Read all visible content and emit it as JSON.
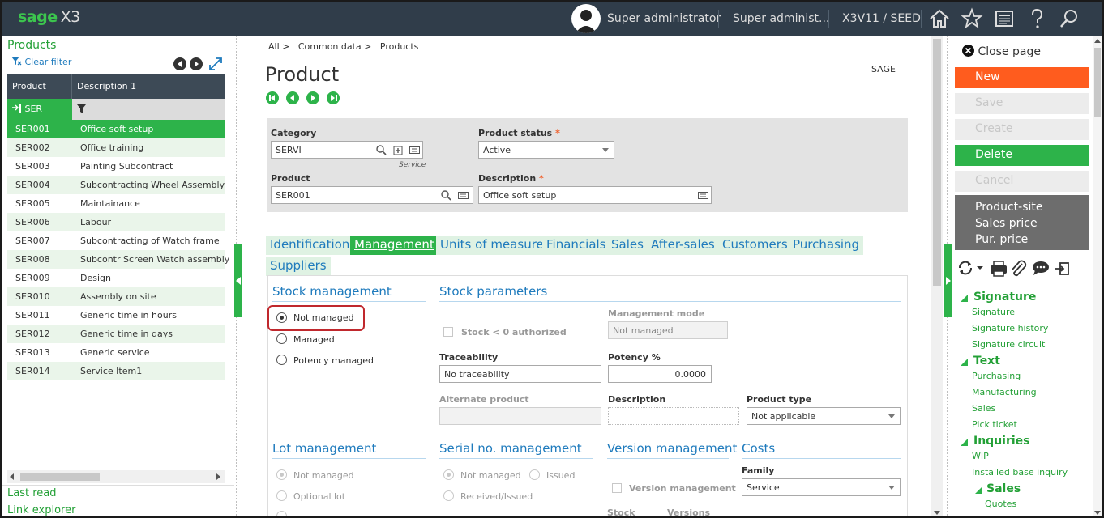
{
  "topbar": {
    "logo_brand": "sage",
    "logo_product": "X3",
    "user": "Super administrator",
    "role": "Super administ...",
    "endpoint": "X3V11 / SEED",
    "icons": [
      "home-icon",
      "star-icon",
      "report-icon",
      "help-icon",
      "search-icon"
    ]
  },
  "left_panel": {
    "title": "Products",
    "clear_filter": "Clear filter",
    "columns": [
      "Product",
      "Description 1"
    ],
    "filter_value": "SER",
    "rows": [
      {
        "code": "SER001",
        "desc": "Office soft setup",
        "selected": true
      },
      {
        "code": "SER002",
        "desc": "Office training"
      },
      {
        "code": "SER003",
        "desc": "Painting Subcontract"
      },
      {
        "code": "SER004",
        "desc": "Subcontracting Wheel Assembly"
      },
      {
        "code": "SER005",
        "desc": "Maintainance"
      },
      {
        "code": "SER006",
        "desc": "Labour"
      },
      {
        "code": "SER007",
        "desc": "Subcontracting of Watch frame"
      },
      {
        "code": "SER008",
        "desc": "Subcontr Screen Watch assembly"
      },
      {
        "code": "SER009",
        "desc": "Design"
      },
      {
        "code": "SER010",
        "desc": "Assembly on site"
      },
      {
        "code": "SER011",
        "desc": "Generic time in hours"
      },
      {
        "code": "SER012",
        "desc": "Generic time in days"
      },
      {
        "code": "SER013",
        "desc": "Generic service"
      },
      {
        "code": "SER014",
        "desc": "Service Item1"
      }
    ],
    "last_read": "Last read",
    "link_explorer": "Link explorer"
  },
  "main": {
    "breadcrumb": [
      "All >",
      "Common data >",
      "Products"
    ],
    "title": "Product",
    "company": "SAGE",
    "header": {
      "category_label": "Category",
      "category_value": "SERVI",
      "category_hint": "Service",
      "status_label": "Product status",
      "status_value": "Active",
      "product_label": "Product",
      "product_value": "SER001",
      "description_label": "Description",
      "description_value": "Office soft setup"
    },
    "tabs": [
      {
        "label": "Identification"
      },
      {
        "label": "Management",
        "active": true
      },
      {
        "label": "Units of measure"
      },
      {
        "label": "Financials"
      },
      {
        "label": "Sales"
      },
      {
        "label": "After-sales"
      },
      {
        "label": "Customers"
      },
      {
        "label": "Purchasing"
      },
      {
        "label": "Suppliers"
      }
    ],
    "stock_management": {
      "title": "Stock management",
      "options": [
        "Not managed",
        "Managed",
        "Potency managed"
      ],
      "selected": "Not managed"
    },
    "stock_parameters": {
      "title": "Stock parameters",
      "stock_negative_label": "Stock < 0 authorized",
      "management_mode_label": "Management mode",
      "management_mode_value": "Not managed",
      "traceability_label": "Traceability",
      "traceability_value": "No traceability",
      "potency_label": "Potency %",
      "potency_value": "0.0000",
      "alternate_label": "Alternate product",
      "alternate_value": "",
      "description_label": "Description",
      "description_value": "",
      "product_type_label": "Product type",
      "product_type_value": "Not applicable"
    },
    "lot_management": {
      "title": "Lot management",
      "options": [
        "Not managed",
        "Optional lot"
      ]
    },
    "serial_management": {
      "title": "Serial no. management",
      "options": [
        "Not managed",
        "Issued",
        "Received/Issued"
      ]
    },
    "version_management": {
      "title": "Version management",
      "checkbox_label": "Version management",
      "col_stock": "Stock",
      "col_versions": "Versions"
    },
    "costs": {
      "title": "Costs",
      "family_label": "Family",
      "family_value": "Service"
    }
  },
  "right_panel": {
    "close_page": "Close page",
    "actions": [
      {
        "label": "New",
        "state": "orange"
      },
      {
        "label": "Save",
        "state": "disabled"
      },
      {
        "label": "Create",
        "state": "disabled"
      },
      {
        "label": "Delete",
        "state": "green"
      },
      {
        "label": "Cancel",
        "state": "disabled"
      }
    ],
    "links": [
      "Product-site",
      "Sales price",
      "Pur. price"
    ],
    "tree": [
      {
        "head": "Signature",
        "items": [
          "Signature",
          "Signature history",
          "Signature circuit"
        ]
      },
      {
        "head": "Text",
        "items": [
          "Purchasing",
          "Manufacturing",
          "Sales",
          "Pick ticket"
        ]
      },
      {
        "head": "Inquiries",
        "items": [
          "WIP",
          "Installed base inquiry"
        ]
      },
      {
        "head": "Sales",
        "items": [
          "Quotes"
        ]
      }
    ]
  },
  "colors": {
    "brand_green": "#2db34a",
    "topbar": "#303d4a",
    "new_button": "#ff5c1e",
    "link_blue": "#1f7bbd",
    "highlight_red": "#c0282d"
  }
}
